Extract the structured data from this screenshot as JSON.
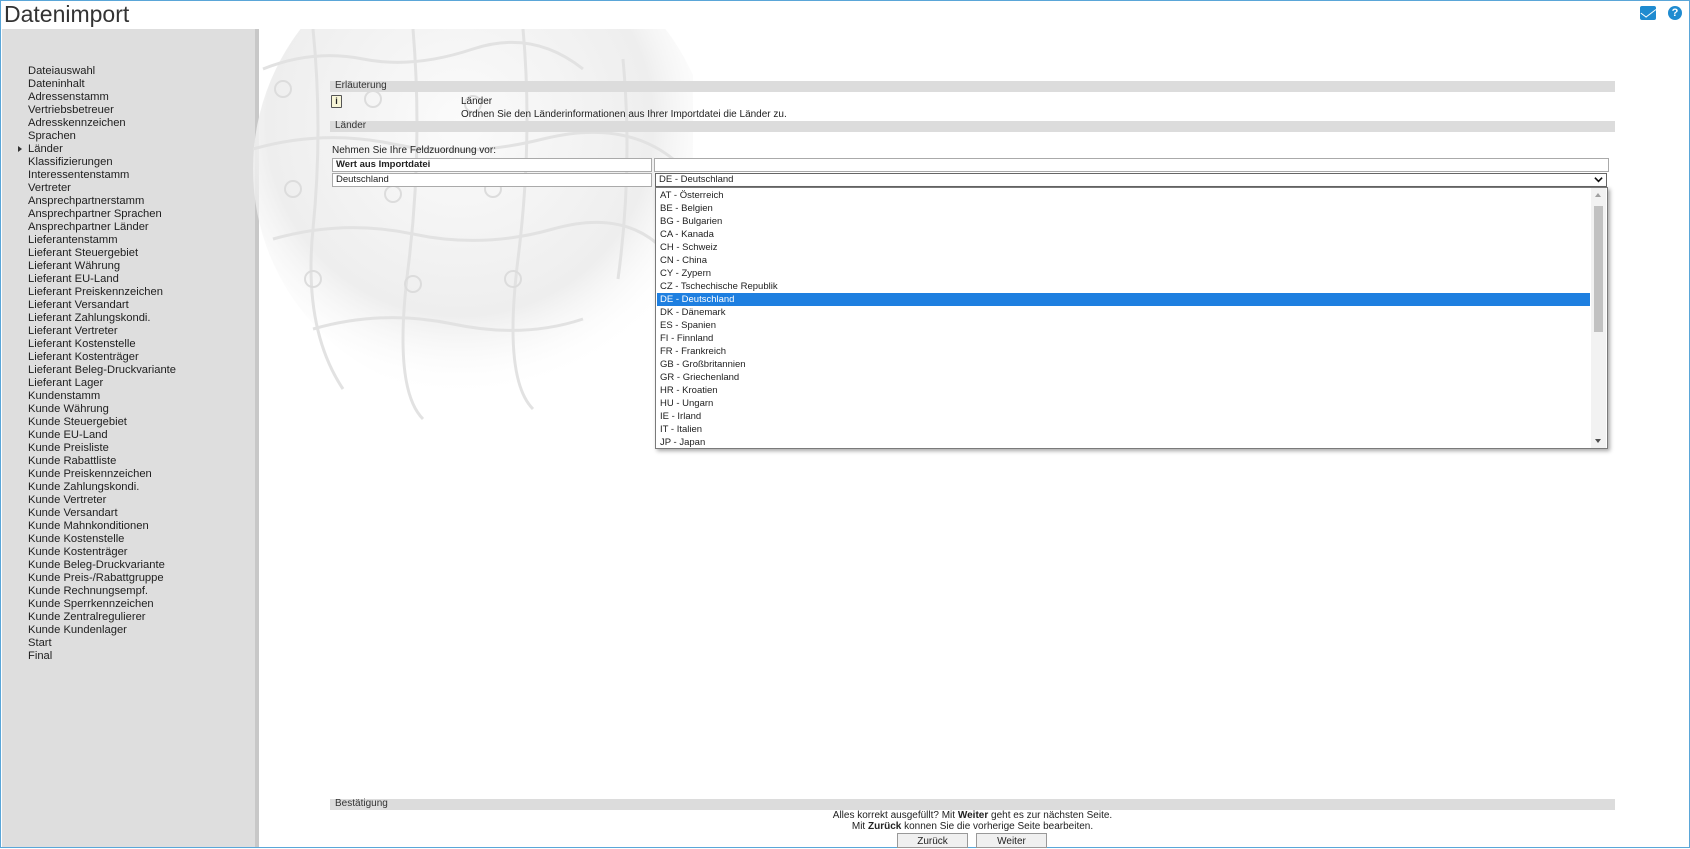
{
  "app": {
    "title": "Datenimport"
  },
  "nav": {
    "items": [
      "Dateiauswahl",
      "Dateninhalt",
      "Adressenstamm",
      "Vertriebsbetreuer",
      "Adresskennzeichen",
      "Sprachen",
      "Länder",
      "Klassifizierungen",
      "Interessentenstamm",
      "Vertreter",
      "Ansprechpartnerstamm",
      "Ansprechpartner Sprachen",
      "Ansprechpartner Länder",
      "Lieferantenstamm",
      "Lieferant Steuergebiet",
      "Lieferant Währung",
      "Lieferant EU-Land",
      "Lieferant Preiskennzeichen",
      "Lieferant Versandart",
      "Lieferant Zahlungskondi.",
      "Lieferant Vertreter",
      "Lieferant Kostenstelle",
      "Lieferant Kostenträger",
      "Lieferant Beleg-Druckvariante",
      "Lieferant Lager",
      "Kundenstamm",
      "Kunde Währung",
      "Kunde Steuergebiet",
      "Kunde EU-Land",
      "Kunde Preisliste",
      "Kunde Rabattliste",
      "Kunde Preiskennzeichen",
      "Kunde Zahlungskondi.",
      "Kunde Vertreter",
      "Kunde Versandart",
      "Kunde Mahnkonditionen",
      "Kunde Kostenstelle",
      "Kunde Kostenträger",
      "Kunde Beleg-Druckvariante",
      "Kunde Preis-/Rabattgruppe",
      "Kunde Rechnungsempf.",
      "Kunde Sperrkennzeichen",
      "Kunde Zentralregulierer",
      "Kunde Kundenlager",
      "Start",
      "Final"
    ],
    "active_index": 6
  },
  "explanation": {
    "header": "Erläuterung",
    "title": "Länder",
    "text": "Ordnen Sie den Länderinformationen aus Ihrer Importdatei die Länder zu."
  },
  "section": {
    "header": "Länder",
    "instruction": "Nehmen Sie Ihre Feldzuordnung vor:",
    "column_header": "Wert aus Importdatei",
    "row_value": "Deutschland",
    "selected": "DE - Deutschland"
  },
  "dropdown": {
    "options": [
      "AT - Österreich",
      "BE - Belgien",
      "BG - Bulgarien",
      "CA - Kanada",
      "CH - Schweiz",
      "CN - China",
      "CY - Zypern",
      "CZ - Tschechische Republik",
      "DE - Deutschland",
      "DK - Dänemark",
      "ES - Spanien",
      "FI - Finnland",
      "FR - Frankreich",
      "GB - Großbritannien",
      "GR - Griechenland",
      "HR - Kroatien",
      "HU - Ungarn",
      "IE - Irland",
      "IT - Italien",
      "JP - Japan"
    ],
    "selected_index": 8
  },
  "confirm": {
    "header": "Bestätigung",
    "line1_a": "Alles korrekt ausgefüllt?  Mit ",
    "line1_b": "Weiter",
    "line1_c": " geht es zur nächsten Seite.",
    "line2_a": "Mit ",
    "line2_b": "Zurück",
    "line2_c": " konnen Sie die vorherige Seite bearbeiten.",
    "back_label": "Zurück",
    "next_label": "Weiter"
  },
  "colors": {
    "selection": "#1e7fe0",
    "frame": "#5aa6d8",
    "icon": "#1f8bd0"
  },
  "icons": [
    "mail-icon",
    "help-icon",
    "info-icon",
    "chevron-down-icon"
  ]
}
